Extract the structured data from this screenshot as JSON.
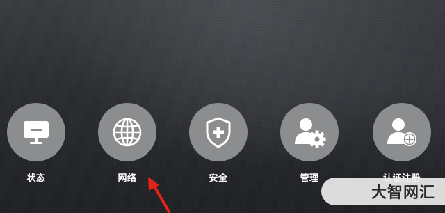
{
  "menu": {
    "items": [
      {
        "label": "状态",
        "icon": "monitor-icon"
      },
      {
        "label": "网络",
        "icon": "globe-icon"
      },
      {
        "label": "安全",
        "icon": "shield-plus-icon"
      },
      {
        "label": "管理",
        "icon": "user-gear-icon"
      },
      {
        "label": "认证注册",
        "icon": "user-add-icon"
      }
    ]
  },
  "watermark": {
    "text": "大智网汇"
  },
  "colors": {
    "icon_circle": "#8c8d8f",
    "label": "#ffffff",
    "arrow": "#e2231a"
  }
}
